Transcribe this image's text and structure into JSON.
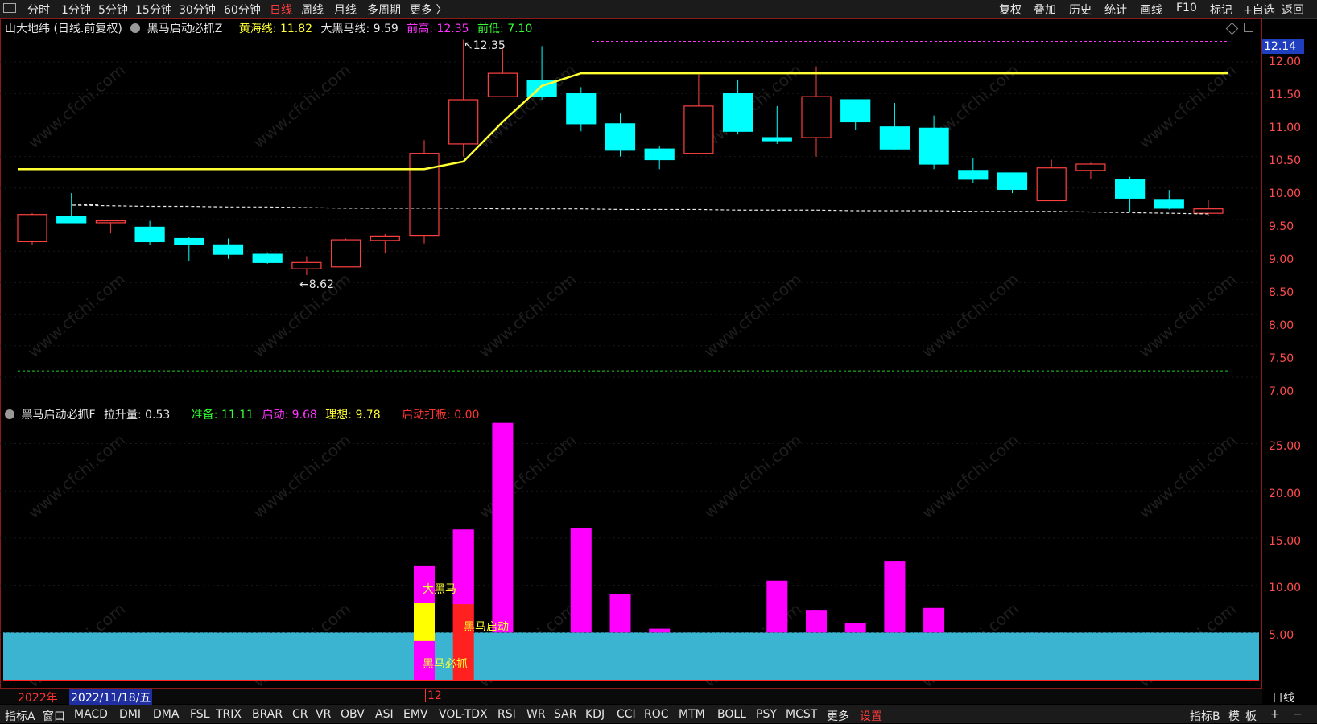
{
  "toolbar": {
    "periods": [
      "分时",
      "1分钟",
      "5分钟",
      "15分钟",
      "30分钟",
      "60分钟",
      "日线",
      "周线",
      "月线",
      "多周期",
      "更多 〉"
    ],
    "active_period": "日线",
    "right_buttons": [
      "复权",
      "叠加",
      "历史",
      "统计",
      "画线",
      "F10",
      "标记",
      "+自选",
      "返回"
    ]
  },
  "main_panel": {
    "stock_title": "山大地纬 (日线.前复权)",
    "indicator_name": "黑马启动必抓Z",
    "huanghai_label": "黄海线:",
    "huanghai_value": "11.82",
    "daheima_label": "大黑马线:",
    "daheima_value": "9.59",
    "qiangao_label": "前高:",
    "qiangao_value": "12.35",
    "qiandi_label": "前低:",
    "qiandi_value": "7.10",
    "high_marker": "12.35",
    "low_marker": "8.62",
    "current_price_tag": "12.14",
    "y_ticks": [
      "12.00",
      "11.50",
      "11.00",
      "10.50",
      "10.00",
      "9.50",
      "9.00",
      "8.50",
      "8.00",
      "7.50",
      "7.00"
    ]
  },
  "sub_panel": {
    "indicator_name": "黑马启动必抓F",
    "lashengliang_label": "拉升量:",
    "lashengliang_value": "0.53",
    "zhunbei_label": "准备:",
    "zhunbei_value": "11.11",
    "qidong_label": "启动:",
    "qidong_value": "9.68",
    "lixiang_label": "理想:",
    "lixiang_value": "9.78",
    "qidongdaban_label": "启动打板:",
    "qidongdaban_value": "0.00",
    "annotation_daheima": "大黑马",
    "annotation_heima_qidong": "黑马启动",
    "annotation_heima_bizhua": "黑马必抓",
    "y_ticks": [
      "25.00",
      "20.00",
      "15.00",
      "10.00",
      "5.00"
    ]
  },
  "date_strip": {
    "year": "2022年",
    "cursor_date": "2022/11/18/五",
    "month_mark": "12",
    "period_label": "日线"
  },
  "bottom_tabs": {
    "left": "指标A",
    "window": "窗口",
    "items": [
      "MACD",
      "DMI",
      "DMA",
      "FSL",
      "TRIX",
      "BRAR",
      "CR",
      "VR",
      "OBV",
      "ASI",
      "EMV",
      "VOL-TDX",
      "RSI",
      "WR",
      "SAR",
      "KDJ",
      "CCI",
      "ROC",
      "MTM",
      "BOLL",
      "PSY",
      "MCST",
      "更多",
      "设置"
    ],
    "right": [
      "指标B",
      "模",
      "板",
      "+",
      "−"
    ]
  },
  "watermark": "www.cfchi.com",
  "colors": {
    "up": "#ff4040",
    "down": "#00ffff",
    "yellow_line": "#ffff33",
    "magenta": "#ff00ff",
    "cyan_fill": "#3ab4d0",
    "red_bar": "#ff2020"
  },
  "chart_data": {
    "type": "candlestick",
    "candles": [
      {
        "o": 9.15,
        "h": 9.6,
        "l": 9.1,
        "c": 9.58
      },
      {
        "o": 9.55,
        "h": 9.92,
        "l": 9.45,
        "c": 9.45
      },
      {
        "o": 9.45,
        "h": 9.5,
        "l": 9.28,
        "c": 9.48
      },
      {
        "o": 9.38,
        "h": 9.48,
        "l": 9.1,
        "c": 9.15
      },
      {
        "o": 9.2,
        "h": 9.22,
        "l": 8.85,
        "c": 9.1
      },
      {
        "o": 9.1,
        "h": 9.2,
        "l": 8.88,
        "c": 8.95
      },
      {
        "o": 8.95,
        "h": 8.98,
        "l": 8.8,
        "c": 8.82
      },
      {
        "o": 8.72,
        "h": 8.92,
        "l": 8.62,
        "c": 8.82
      },
      {
        "o": 8.75,
        "h": 9.2,
        "l": 8.75,
        "c": 9.18
      },
      {
        "o": 9.17,
        "h": 9.27,
        "l": 8.97,
        "c": 9.24
      },
      {
        "o": 9.25,
        "h": 10.76,
        "l": 9.12,
        "c": 10.55
      },
      {
        "o": 10.7,
        "h": 12.35,
        "l": 10.5,
        "c": 11.4
      },
      {
        "o": 11.45,
        "h": 12.2,
        "l": 11.45,
        "c": 11.82
      },
      {
        "o": 11.7,
        "h": 12.25,
        "l": 11.4,
        "c": 11.45
      },
      {
        "o": 11.5,
        "h": 11.6,
        "l": 10.9,
        "c": 11.02
      },
      {
        "o": 11.02,
        "h": 11.18,
        "l": 10.5,
        "c": 10.6
      },
      {
        "o": 10.62,
        "h": 10.67,
        "l": 10.3,
        "c": 10.45
      },
      {
        "o": 10.55,
        "h": 11.8,
        "l": 10.55,
        "c": 11.3
      },
      {
        "o": 11.5,
        "h": 11.72,
        "l": 10.85,
        "c": 10.9
      },
      {
        "o": 10.8,
        "h": 11.3,
        "l": 10.7,
        "c": 10.75
      },
      {
        "o": 10.8,
        "h": 11.93,
        "l": 10.5,
        "c": 11.45
      },
      {
        "o": 11.4,
        "h": 11.4,
        "l": 10.92,
        "c": 11.05
      },
      {
        "o": 10.97,
        "h": 11.35,
        "l": 10.6,
        "c": 10.62
      },
      {
        "o": 10.95,
        "h": 11.15,
        "l": 10.3,
        "c": 10.38
      },
      {
        "o": 10.28,
        "h": 10.48,
        "l": 10.08,
        "c": 10.14
      },
      {
        "o": 10.24,
        "h": 10.24,
        "l": 9.92,
        "c": 9.98
      },
      {
        "o": 9.8,
        "h": 10.45,
        "l": 9.8,
        "c": 10.32
      },
      {
        "o": 10.28,
        "h": 10.4,
        "l": 10.15,
        "c": 10.38
      },
      {
        "o": 10.13,
        "h": 10.18,
        "l": 9.62,
        "c": 9.84
      },
      {
        "o": 9.82,
        "h": 9.97,
        "l": 9.66,
        "c": 9.68
      },
      {
        "o": 9.6,
        "h": 9.82,
        "l": 9.56,
        "c": 9.67
      }
    ],
    "yellow_line": [
      10.3,
      10.3,
      10.3,
      10.3,
      10.3,
      10.3,
      10.3,
      10.3,
      10.3,
      10.3,
      10.3,
      10.42,
      11.05,
      11.62,
      11.82,
      11.82,
      11.82,
      11.82,
      11.82,
      11.82,
      11.82,
      11.82,
      11.82,
      11.82,
      11.82,
      11.82,
      11.82,
      11.82,
      11.82,
      11.82,
      11.82
    ],
    "white_dashed": [
      9.74,
      9.73,
      9.72,
      9.71,
      9.71,
      9.7,
      9.7,
      9.69,
      9.68,
      9.68,
      9.68,
      9.68,
      9.67,
      9.67,
      9.67,
      9.66,
      9.66,
      9.66,
      9.65,
      9.65,
      9.65,
      9.64,
      9.64,
      9.64,
      9.63,
      9.63,
      9.63,
      9.62,
      9.61,
      9.6,
      9.59
    ],
    "magenta_dashed_level": 12.35,
    "green_dashed_level": 7.1,
    "ylim": [
      6.85,
      12.55
    ],
    "sub_bars": [
      null,
      null,
      null,
      null,
      null,
      null,
      null,
      null,
      null,
      null,
      12.1,
      15.9,
      27.2,
      null,
      16.1,
      9.1,
      5.4,
      null,
      null,
      10.5,
      7.4,
      6.0,
      12.6,
      7.6,
      null,
      null,
      null,
      null,
      null,
      null,
      null
    ],
    "sub_ylim": [
      0,
      29
    ],
    "cyan_band": 5.0
  }
}
